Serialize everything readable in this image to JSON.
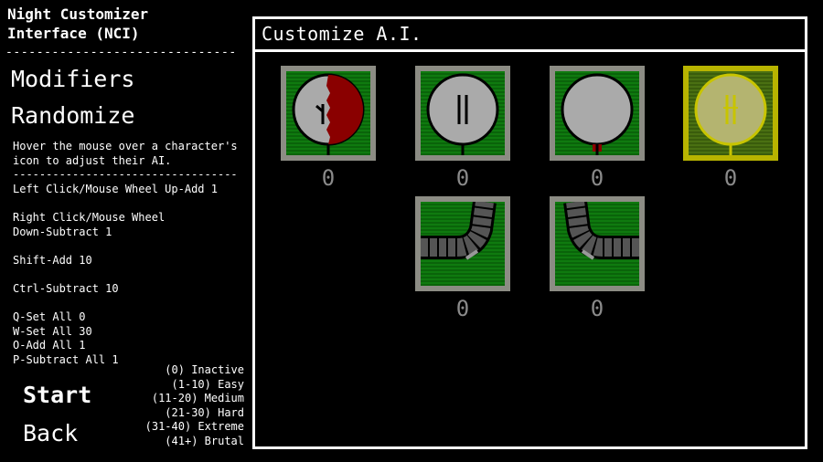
{
  "sidebar": {
    "title": "Night Customizer\nInterface (NCI)",
    "separator": "------------------------------",
    "modifiers_label": "Modifiers",
    "randomize_label": "Randomize",
    "instructions": "Hover the mouse over a character's\nicon to adjust their AI.\n----------------------------------\nLeft Click/Mouse Wheel Up-Add 1\n\nRight Click/Mouse Wheel\nDown-Subtract 1\n\nShift-Add 10\n\nCtrl-Subtract 10\n\nQ-Set All 0\nW-Set All 30\nO-Add All 1\nP-Subtract All 1",
    "difficulty_legend": "(0) Inactive\n(1-10) Easy\n(11-20) Medium\n(21-30) Hard\n(31-40) Extreme\n(41+) Brutal",
    "start_label": "Start",
    "back_label": "Back"
  },
  "panel": {
    "title": "Customize A.I.",
    "characters": [
      {
        "icon": "bloody-ball-icon",
        "ai_level": "0",
        "selected": false
      },
      {
        "icon": "eyes-ball-icon",
        "ai_level": "0",
        "selected": false
      },
      {
        "icon": "blank-ball-icon",
        "ai_level": "0",
        "selected": false
      },
      {
        "icon": "eyes-ball-icon",
        "ai_level": "0",
        "selected": true
      },
      {
        "icon": "tentacle-right-icon",
        "ai_level": "0",
        "selected": false
      },
      {
        "icon": "tentacle-left-icon",
        "ai_level": "0",
        "selected": false
      }
    ]
  },
  "colors": {
    "card_border": "#8c8c84",
    "card_selected_border": "#b8b400",
    "card_bg": "#0f7a0f",
    "count_text": "#8a8a8a"
  }
}
